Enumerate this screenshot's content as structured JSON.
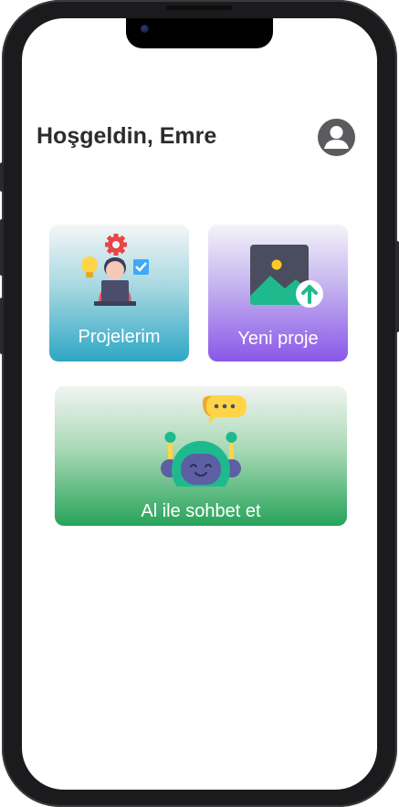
{
  "header": {
    "greeting": "Hoşgeldin, Emre",
    "profile_icon": "user-circle-icon"
  },
  "cards": [
    {
      "label": "Projelerim",
      "icon": "developer-laptop-icon",
      "color": "#2ea7c5"
    },
    {
      "label": "Yeni proje",
      "icon": "image-upload-icon",
      "color": "#8a57e8"
    },
    {
      "label": "Al ile sohbet et",
      "icon": "chatbot-robot-icon",
      "color": "#27a35a"
    }
  ]
}
